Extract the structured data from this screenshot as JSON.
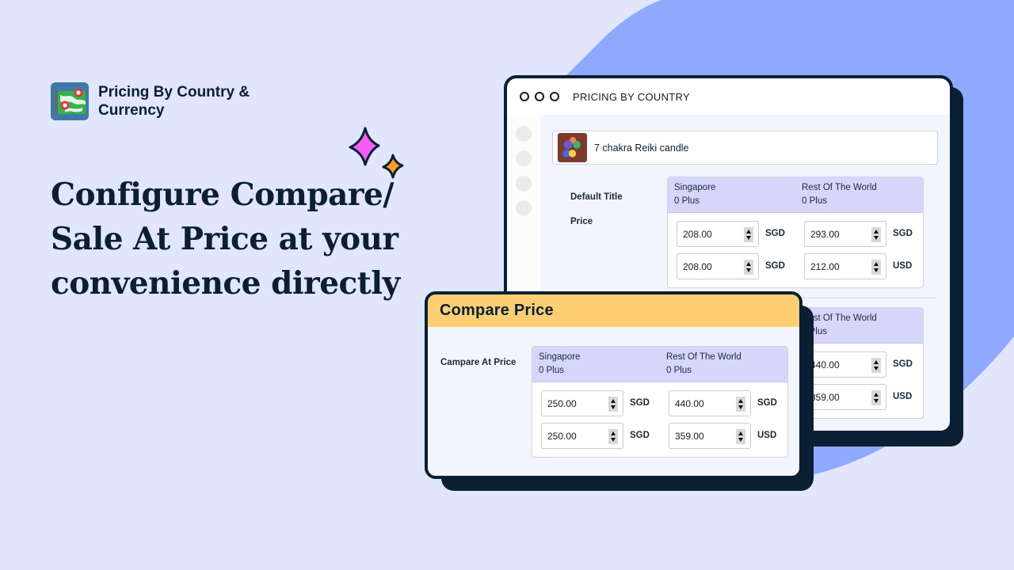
{
  "brand": {
    "name": "Pricing By Country & Currency",
    "logo_icon": "map-pins-icon"
  },
  "headline": "Configure Compare/ Sale At Price at your convenience directly",
  "colors": {
    "background": "#e1e6fc",
    "blob": "#8ea9fd",
    "dark": "#0a1f33",
    "table_header": "#d6d6fb",
    "compare_header": "#fdcf72",
    "sparkle_pink": "#f75cf7",
    "sparkle_orange": "#ff9c24"
  },
  "window": {
    "title": "PRICING BY COUNTRY",
    "product": {
      "name": "7 chakra Reiki candle",
      "thumbnail_icon": "candle-product-image"
    },
    "variant_label": "Default Title",
    "price_label": "Price",
    "price_table": {
      "columns": [
        {
          "country": "Singapore",
          "tier": "0 Plus"
        },
        {
          "country": "Rest Of The World",
          "tier": "0 Plus"
        }
      ],
      "rows": [
        [
          {
            "value": "208.00",
            "currency": "SGD"
          },
          {
            "value": "293.00",
            "currency": "SGD"
          }
        ],
        [
          {
            "value": "208.00",
            "currency": "SGD"
          },
          {
            "value": "212.00",
            "currency": "USD"
          }
        ]
      ]
    },
    "second_table": {
      "columns": [
        {
          "country": "Rest Of The World",
          "tier": "0 Plus"
        }
      ],
      "rows": [
        [
          {
            "value": "440.00",
            "currency": "SGD"
          }
        ],
        [
          {
            "value": "359.00",
            "currency": "USD"
          }
        ]
      ]
    }
  },
  "compare_card": {
    "title": "Compare Price",
    "label": "Campare At Price",
    "table": {
      "columns": [
        {
          "country": "Singapore",
          "tier": "0 Plus"
        },
        {
          "country": "Rest Of The World",
          "tier": "0 Plus"
        }
      ],
      "rows": [
        [
          {
            "value": "250.00",
            "currency": "SGD"
          },
          {
            "value": "440.00",
            "currency": "SGD"
          }
        ],
        [
          {
            "value": "250.00",
            "currency": "SGD"
          },
          {
            "value": "359.00",
            "currency": "USD"
          }
        ]
      ]
    }
  }
}
